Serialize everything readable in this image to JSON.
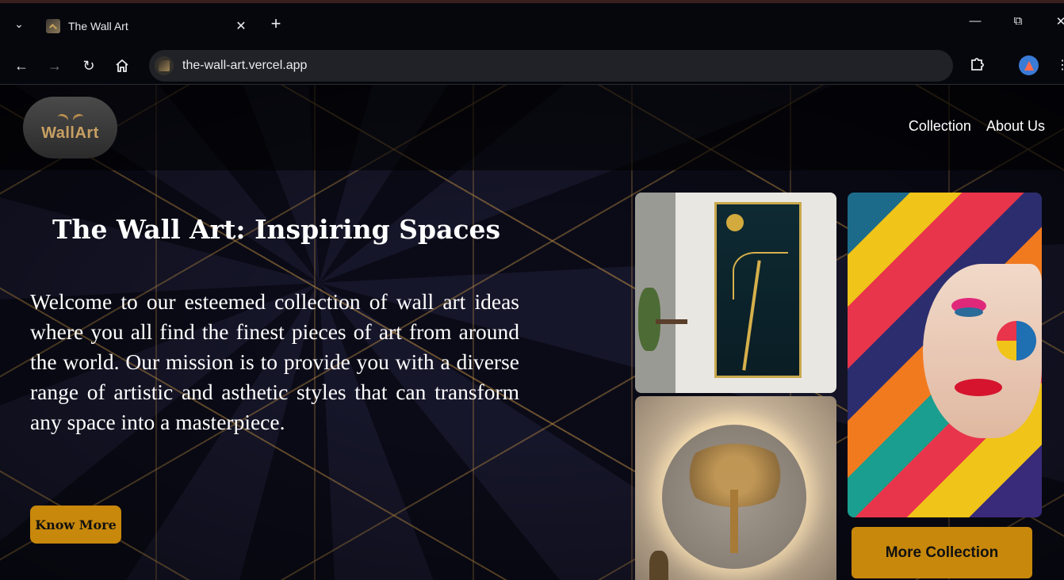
{
  "browser": {
    "tab_title": "The Wall Art",
    "url": "the-wall-art.vercel.app",
    "icons": {
      "tab_list": "chevron-down-icon",
      "close_tab": "close-icon",
      "new_tab": "plus-icon",
      "back": "arrow-left-icon",
      "forward": "arrow-right-icon",
      "reload": "reload-icon",
      "home": "home-icon",
      "extensions": "puzzle-icon",
      "profile": "profile-icon",
      "menu": "more-vertical-icon"
    }
  },
  "site": {
    "logo_text": "WallArt",
    "nav": [
      "Collection",
      "About Us"
    ],
    "hero_title": "The Wall Art: Inspiring Spaces",
    "hero_text": "Welcome to our esteemed collection of wall art ideas where you all find the finest pieces of art from around the world. Our mission is to provide you with a diverse range of artistic and asthetic styles that can transform any space into a masterpiece.",
    "know_more": "Know More",
    "more_collection": "More Collection",
    "colors": {
      "accent": "#c8880b",
      "logo_gold": "#c8a063",
      "background": "#0d0d1a"
    }
  }
}
